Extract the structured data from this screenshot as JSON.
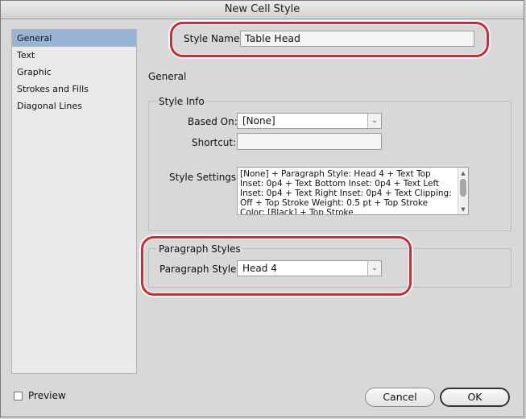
{
  "window": {
    "title": "New Cell Style"
  },
  "sidebar": {
    "items": [
      {
        "label": "General",
        "selected": true
      },
      {
        "label": "Text"
      },
      {
        "label": "Graphic"
      },
      {
        "label": "Strokes and Fills"
      },
      {
        "label": "Diagonal Lines"
      }
    ]
  },
  "style_name": {
    "label": "Style Name:",
    "value": "Table Head"
  },
  "section": {
    "title": "General"
  },
  "style_info": {
    "title": "Style Info",
    "based_on": {
      "label": "Based On:",
      "value": "[None]"
    },
    "shortcut": {
      "label": "Shortcut:",
      "value": ""
    },
    "style_settings": {
      "label": "Style Settings:",
      "text": "[None] + Paragraph Style: Head 4 + Text Top Inset: 0p4 + Text Bottom Inset: 0p4 + Text Left Inset: 0p4 + Text Right Inset: 0p4 + Text Clipping: Off + Top Stroke Weight: 0.5 pt + Top Stroke Color: [Black] + Top Stroke"
    }
  },
  "paragraph_styles": {
    "title": "Paragraph Styles",
    "paragraph_style": {
      "label": "Paragraph Style:",
      "value": "Head 4"
    }
  },
  "footer": {
    "preview_label": "Preview",
    "preview_checked": false,
    "cancel_label": "Cancel",
    "ok_label": "OK"
  },
  "colors": {
    "highlight_ring": "#cf2a36",
    "sidebar_selected": "#9ab4d6"
  }
}
